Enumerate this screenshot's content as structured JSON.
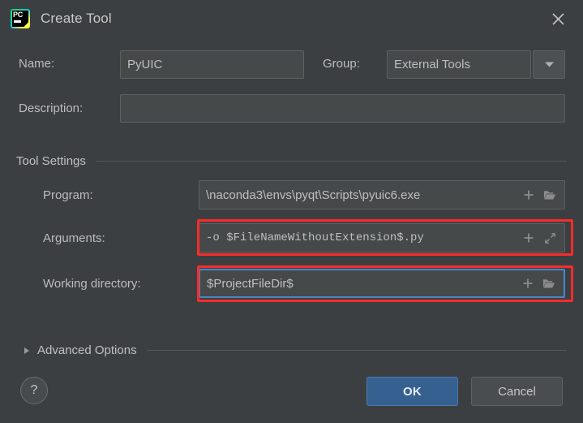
{
  "window": {
    "title": "Create Tool",
    "icon": "pycharm-logo-icon",
    "close_icon": "close-icon"
  },
  "form": {
    "name_label": "Name:",
    "name_value": "PyUIC",
    "group_label": "Group:",
    "group_value": "External Tools",
    "group_arrow_icon": "chevron-down-icon",
    "description_label": "Description:",
    "description_value": ""
  },
  "tool_settings": {
    "section_title": "Tool Settings",
    "program_label": "Program:",
    "program_value": "\\naconda3\\envs\\pyqt\\Scripts\\pyuic6.exe",
    "program_insert_icon": "plus-icon",
    "program_browse_icon": "folder-icon",
    "arguments_label": "Arguments:",
    "arguments_value": "-o $FileNameWithoutExtension$.py",
    "arguments_insert_icon": "plus-icon",
    "arguments_expand_icon": "expand-icon",
    "working_dir_label": "Working directory:",
    "working_dir_value": "$ProjectFileDir$",
    "working_dir_insert_icon": "plus-icon",
    "working_dir_browse_icon": "folder-icon"
  },
  "advanced": {
    "title": "Advanced Options",
    "toggle_icon": "triangle-right-icon",
    "expanded": false
  },
  "footer": {
    "help_label": "?",
    "ok_label": "OK",
    "cancel_label": "Cancel"
  },
  "annotations": {
    "highlight_color": "#fb2b2b",
    "focus_color": "#4a88c7",
    "accent_color": "#36608f"
  }
}
